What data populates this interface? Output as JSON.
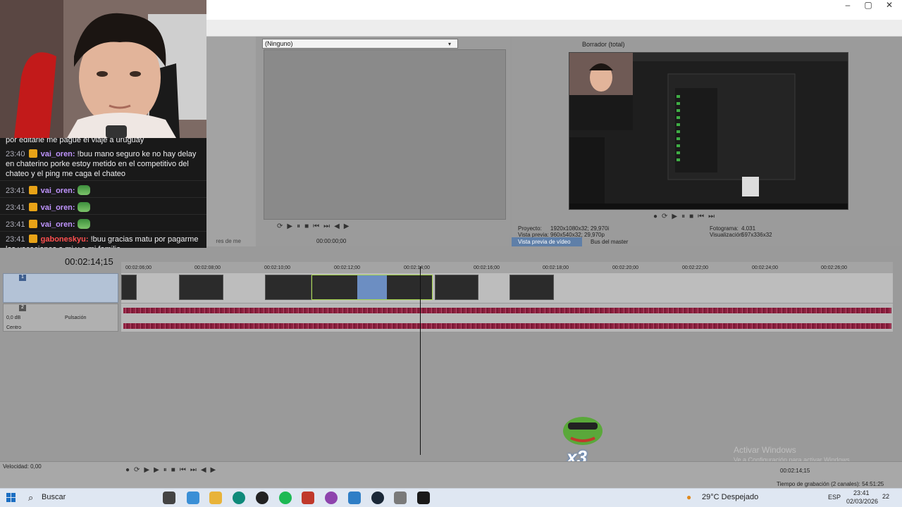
{
  "window": {
    "minimize": "–",
    "maximize": "▢",
    "close": "✕"
  },
  "chat": {
    "messages": [
      {
        "text_head": "por editarle me pague el viaje a uruguay"
      },
      {
        "time": "23:40",
        "user": "vai_oren:",
        "text": "!buu mano seguro ke no hay delay en chaterino porke estoy metido en el competitivo del chateo y el ping me caga el chateo"
      },
      {
        "time": "23:41",
        "user": "vai_oren:"
      },
      {
        "time": "23:41",
        "user": "vai_oren:"
      },
      {
        "time": "23:41",
        "user": "vai_oren:"
      },
      {
        "time": "23:41",
        "user": "gaboneskyu:",
        "text": "!buu gracias matu por pagarme las vacaciones a mi y a mi familia"
      }
    ]
  },
  "trimmer": {
    "selector": "(Ninguno)",
    "timecode": "00:00:00;00",
    "left_tab": "res de me"
  },
  "preview": {
    "mode": "Borrador (total)",
    "project_label": "Proyecto:",
    "project_value": "1920x1080x32; 29,970i",
    "preview_label": "Vista previa:",
    "preview_value": "960x540x32; 29,970p",
    "frame_label": "Fotograma:",
    "frame_value": "4.031",
    "display_label": "Visualización:",
    "display_value": "597x336x32",
    "tab_preview": "Vista previa de vídeo",
    "tab_master": "Bus del master"
  },
  "timeline": {
    "timecode": "00:02:14;15",
    "ruler": [
      "00:02:06;00",
      "00:02:08;00",
      "00:02:10;00",
      "00:02:12;00",
      "00:02:14;00",
      "00:02:16;00",
      "00:02:18;00",
      "00:02:20;00",
      "00:02:22;00",
      "00:02:24;00",
      "00:02:26;00"
    ],
    "track1_num": "1",
    "track2_num": "2",
    "volume": "0,0 dB",
    "mode": "Pulsación",
    "pan": "Centro",
    "speed": "Velocidad: 0,00",
    "cursor_time": "00:02:14;15",
    "record_time": "Tiempo de grabación (2 canales): 54:51:25"
  },
  "watermark": {
    "line1": "Activar Windows",
    "line2": "Ve a Configuración para activar Windows."
  },
  "overlay": {
    "multiplier": "x3"
  },
  "taskbar": {
    "search": "Buscar",
    "weather": "29°C Despejado",
    "lang": "ESP",
    "time": "23:41",
    "date": "02/03/2026",
    "notif": "22"
  },
  "colors": {
    "selection": "#b3c2d6",
    "audio_wave": "#8f2140",
    "chat_bg": "#191919",
    "user1": "#bf94ff",
    "user2": "#ff4f4f"
  }
}
